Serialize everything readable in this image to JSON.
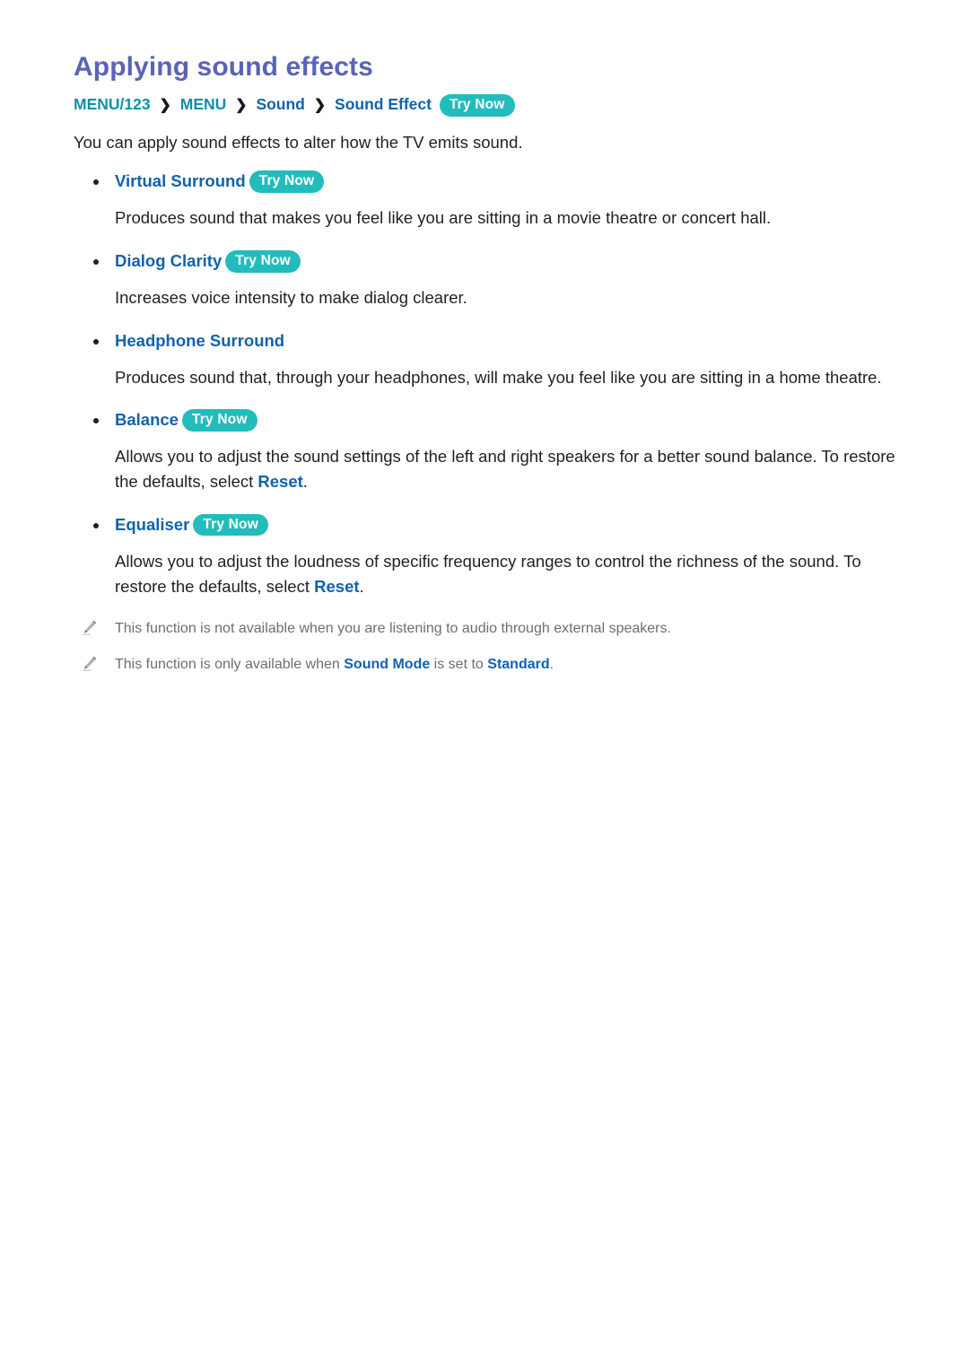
{
  "page": {
    "title": "Applying sound effects",
    "intro": "You can apply sound effects to alter how the TV emits sound."
  },
  "breadcrumb": {
    "segments": [
      {
        "label": "MENU/123",
        "style": "teal"
      },
      {
        "label": "MENU",
        "style": "teal"
      },
      {
        "label": "Sound",
        "style": "blue"
      },
      {
        "label": "Sound Effect",
        "style": "blue"
      }
    ],
    "separator": "❯",
    "try_now_label": "Try Now"
  },
  "badges": {
    "try_now": "Try Now"
  },
  "features": [
    {
      "label": "Virtual Surround",
      "has_try_now": true,
      "desc_pre": "Produces sound that makes you feel like you are sitting in a movie theatre or concert hall.",
      "desc_keyword": "",
      "desc_post": ""
    },
    {
      "label": "Dialog Clarity",
      "has_try_now": true,
      "desc_pre": "Increases voice intensity to make dialog clearer.",
      "desc_keyword": "",
      "desc_post": ""
    },
    {
      "label": "Headphone Surround",
      "has_try_now": false,
      "desc_pre": "Produces sound that, through your headphones, will make you feel like you are sitting in a home theatre.",
      "desc_keyword": "",
      "desc_post": ""
    },
    {
      "label": "Balance",
      "has_try_now": true,
      "desc_pre": "Allows you to adjust the sound settings of the left and right speakers for a better sound balance. To restore the defaults, select ",
      "desc_keyword": "Reset",
      "desc_post": "."
    },
    {
      "label": "Equaliser",
      "has_try_now": true,
      "desc_pre": "Allows you to adjust the loudness of specific frequency ranges to control the richness of the sound. To restore the defaults, select ",
      "desc_keyword": "Reset",
      "desc_post": "."
    }
  ],
  "notes": [
    {
      "icon": "pencil-icon",
      "pre": "This function is not available when you are listening to audio through external speakers.",
      "kw1": "",
      "mid": "",
      "kw2": "",
      "post": ""
    },
    {
      "icon": "pencil-icon",
      "pre": "This function is only available when ",
      "kw1": "Sound Mode",
      "mid": " is set to ",
      "kw2": "Standard",
      "post": "."
    }
  ],
  "colors": {
    "title": "#5b63b8",
    "teal": "#0f8fa9",
    "blue": "#1162ad",
    "badge": "#23bcbc",
    "body": "#231f20",
    "note": "#6d6e71"
  }
}
